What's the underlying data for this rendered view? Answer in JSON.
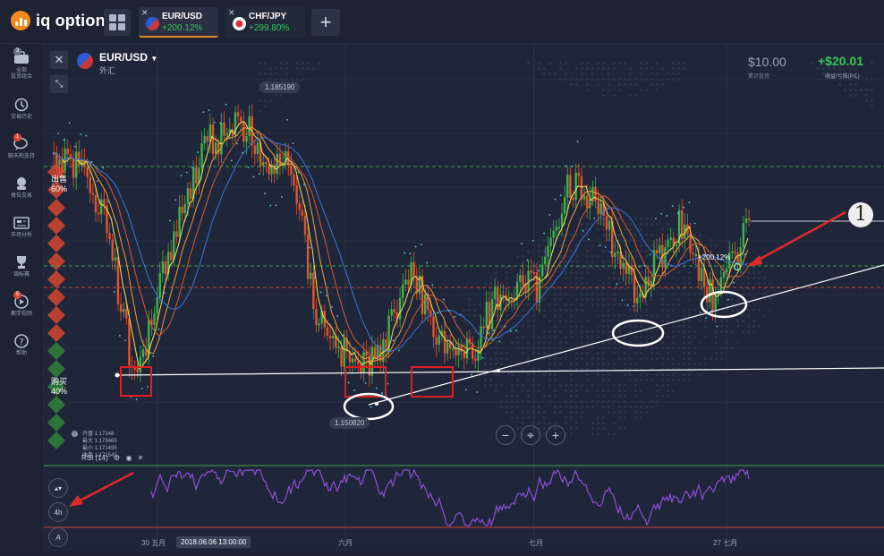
{
  "app": {
    "logo_text": "iq option",
    "brand_color": "#f38a1e"
  },
  "tabs": [
    {
      "name": "EUR/USD",
      "pct": "+200.12%",
      "active": true
    },
    {
      "name": "CHF/JPY",
      "pct": "+299.80%",
      "active": false
    }
  ],
  "add_tab_label": "+",
  "sidebar": {
    "items": [
      {
        "label": "全部\n投资组合",
        "icon": "portfolio-icon",
        "badge": "3"
      },
      {
        "label": "交易历史",
        "icon": "history-icon"
      },
      {
        "label": "聊天和支持",
        "icon": "chat-icon",
        "badge": "1"
      },
      {
        "label": "每位交易",
        "icon": "traders-icon"
      },
      {
        "label": "市场分析",
        "icon": "news-icon"
      },
      {
        "label": "锦标赛",
        "icon": "trophy-icon"
      },
      {
        "label": "教学视频",
        "icon": "video-icon",
        "badge": "5"
      },
      {
        "label": "帮助",
        "icon": "help-icon"
      }
    ]
  },
  "asset": {
    "name": "EUR/USD",
    "category": "外汇"
  },
  "investment": {
    "amount": "$10.00",
    "label": "累计投资"
  },
  "profit": {
    "amount": "+$20.01",
    "label": "收益/亏损(P/L)"
  },
  "sentiment": {
    "sell_label": "出售",
    "sell_pct": "60%",
    "buy_label": "购买",
    "buy_pct": "40%"
  },
  "price_tags": {
    "high": "1.185190",
    "low": "1.150820"
  },
  "ohlc": {
    "open": "开盘 1.17248",
    "high": "最大 1.173465",
    "low": "最小 1.171495",
    "close": "收盘 1.171545"
  },
  "zoom": {
    "out": "−",
    "reset": "⌖",
    "in": "+"
  },
  "indicator": {
    "name": "RSI (14)"
  },
  "timeframe": {
    "chart_type": "▴▾",
    "period": "4h",
    "draw": "A"
  },
  "xaxis": {
    "labels": [
      "30 五月",
      "六月",
      "七月",
      "27 七月"
    ],
    "cursor_date": "2018.06.06 13:00:00"
  },
  "trade": {
    "pct": "+200.12%"
  },
  "callout": {
    "number": "1"
  },
  "colors": {
    "up": "#3fb24b",
    "down": "#e5532d",
    "sell_band": "#c9462f",
    "buy_band": "#2e7d3a",
    "rsi": "#8d4fd8"
  }
}
